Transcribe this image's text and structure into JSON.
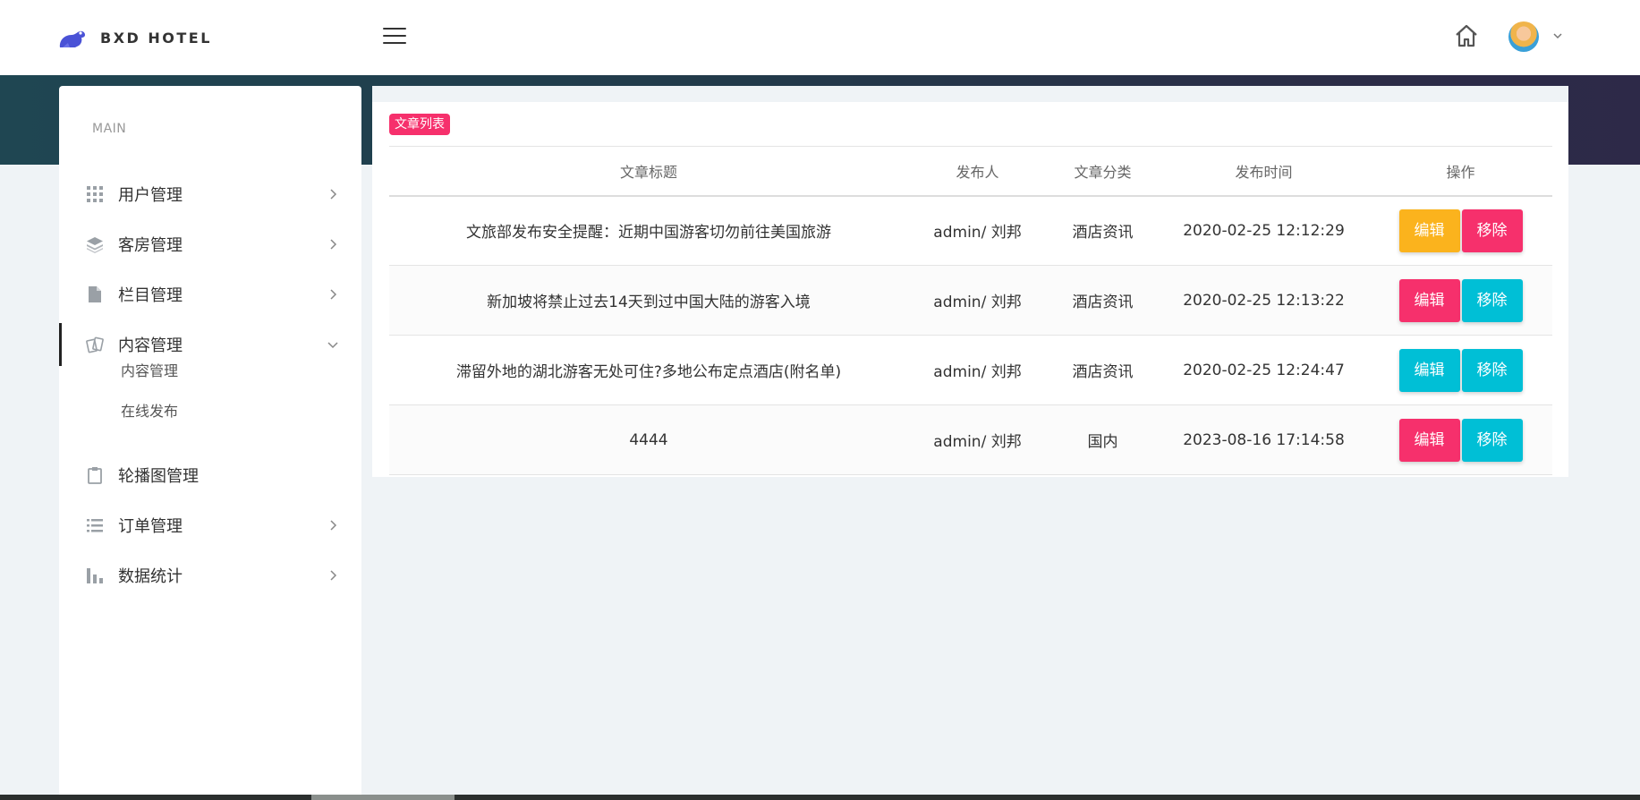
{
  "brand": {
    "name": "BXD HOTEL"
  },
  "colors": {
    "accent_pink": "#f6306c",
    "warning_orange": "#fbb31d",
    "info_cyan": "#00bfd6",
    "header_band_start": "#1f4652",
    "header_band_end": "#2d2948"
  },
  "header": {
    "menu_icon": "hamburger-icon",
    "home_icon": "home-icon",
    "user_icon": "avatar",
    "caret_icon": "chevron-down-icon"
  },
  "sidebar": {
    "heading": "MAIN",
    "items": [
      {
        "label": "用户管理",
        "icon": "grid-icon",
        "expanded": false
      },
      {
        "label": "客房管理",
        "icon": "layers-icon",
        "expanded": false
      },
      {
        "label": "栏目管理",
        "icon": "file-icon",
        "expanded": false
      },
      {
        "label": "内容管理",
        "icon": "cards-icon",
        "expanded": true,
        "children": [
          {
            "label": "内容管理"
          },
          {
            "label": "在线发布"
          }
        ]
      },
      {
        "label": "轮播图管理",
        "icon": "clipboard-icon"
      },
      {
        "label": "订单管理",
        "icon": "list-icon",
        "expanded": false
      },
      {
        "label": "数据统计",
        "icon": "bar-chart-icon",
        "expanded": false
      }
    ]
  },
  "main": {
    "badge": "文章列表",
    "table": {
      "headers": [
        "文章标题",
        "发布人",
        "文章分类",
        "发布时间",
        "操作"
      ],
      "rows": [
        {
          "title": "文旅部发布安全提醒：近期中国游客切勿前往美国旅游",
          "author": "admin/ 刘邦",
          "category": "酒店资讯",
          "time": "2020-02-25 12:12:29",
          "edit": {
            "label": "编辑",
            "color": "#fbb31d"
          },
          "remove": {
            "label": "移除",
            "color": "#f6306c"
          }
        },
        {
          "title": "新加坡将禁止过去14天到过中国大陆的游客入境",
          "author": "admin/ 刘邦",
          "category": "酒店资讯",
          "time": "2020-02-25 12:13:22",
          "edit": {
            "label": "编辑",
            "color": "#f6306c"
          },
          "remove": {
            "label": "移除",
            "color": "#00bfd6"
          }
        },
        {
          "title": "滞留外地的湖北游客无处可住?多地公布定点酒店(附名单)",
          "author": "admin/ 刘邦",
          "category": "酒店资讯",
          "time": "2020-02-25 12:24:47",
          "edit": {
            "label": "编辑",
            "color": "#00bfd6"
          },
          "remove": {
            "label": "移除",
            "color": "#00bfd6"
          }
        },
        {
          "title": "4444",
          "author": "admin/ 刘邦",
          "category": "国内",
          "time": "2023-08-16 17:14:58",
          "edit": {
            "label": "编辑",
            "color": "#f6306c"
          },
          "remove": {
            "label": "移除",
            "color": "#00bfd6"
          }
        }
      ]
    }
  }
}
